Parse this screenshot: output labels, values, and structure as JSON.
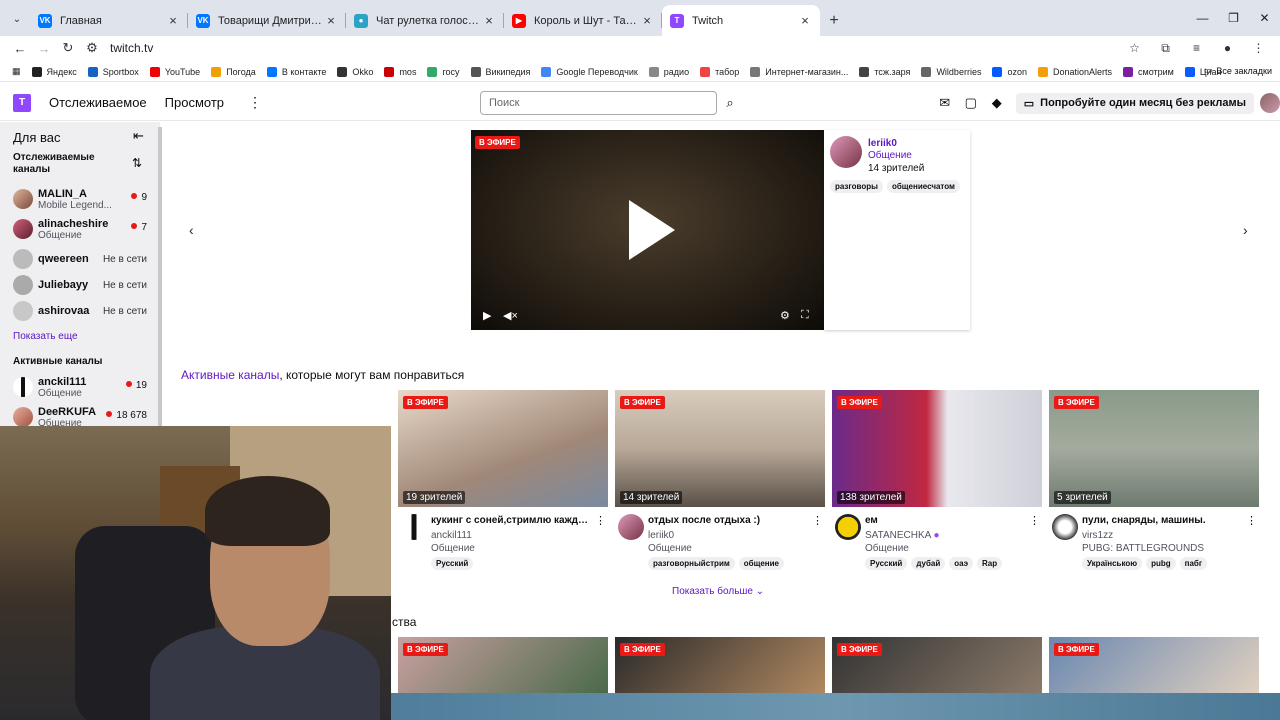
{
  "browser": {
    "tabs": [
      {
        "title": "Главная",
        "icon_color": "#0077ff"
      },
      {
        "title": "Товарищи Дмитрия Зорина –",
        "icon_color": "#0077ff"
      },
      {
        "title": "Чат рулетка голосовая — Ne",
        "icon_color": "#2aa3c7"
      },
      {
        "title": "Король и Шут - Танец злобн",
        "icon_color": "#ff0000"
      },
      {
        "title": "Twitch",
        "icon_color": "#9147ff"
      }
    ],
    "url": "twitch.tv",
    "bookmarks": [
      "Яндекс",
      "Sportbox",
      "YouTube",
      "Погода",
      "В контакте",
      "Okko",
      "mos",
      "госу",
      "Википедия",
      "Google Переводчик",
      "радио",
      "табор",
      "Интернет-магазин...",
      "тсж.заря",
      "Wildberries",
      "ozon",
      "DonationAlerts",
      "смотрим",
      "Циан"
    ],
    "all_bookmarks": "Все закладки"
  },
  "nav": {
    "following": "Отслеживаемое",
    "browse": "Просмотр",
    "search_placeholder": "Поиск",
    "promo": "Попробуйте один месяц без рекламы"
  },
  "sidebar": {
    "title": "Для вас",
    "followed_title": "Отслеживаемые каналы",
    "followed": [
      {
        "name": "MALIN_A",
        "category": "Mobile Legend...",
        "viewers": "9",
        "online": true
      },
      {
        "name": "alinacheshire",
        "category": "Общение",
        "viewers": "7",
        "online": true
      },
      {
        "name": "qweereen",
        "status": "Не в сети",
        "online": false
      },
      {
        "name": "Juliebayy",
        "status": "Не в сети",
        "online": false
      },
      {
        "name": "ashirovaa",
        "status": "Не в сети",
        "online": false
      }
    ],
    "show_more": "Показать еще",
    "active_title": "Активные каналы",
    "active": [
      {
        "name": "anckil111",
        "category": "Общение",
        "viewers": "19"
      },
      {
        "name": "DeeRKUFA",
        "category": "Общение",
        "viewers": "18 678"
      }
    ]
  },
  "featured": {
    "live": "В ЭФИРЕ",
    "name": "leriik0",
    "category": "Общение",
    "viewers": "14 зрителей",
    "tags": [
      "разговоры",
      "общениесчатом"
    ]
  },
  "section": {
    "title_accent": "Активные каналы",
    "title_rest": ", которые могут вам понравиться",
    "cards": [
      {
        "live": "В ЭФИРЕ",
        "views": "19 зрителей",
        "title": "кукинг с соней,стримлю каждый...",
        "user": "anckil111",
        "category": "Общение",
        "tags": [
          "Русский"
        ]
      },
      {
        "live": "В ЭФИРЕ",
        "views": "14 зрителей",
        "title": "отдых после отдыха :)",
        "user": "leriik0",
        "category": "Общение",
        "tags": [
          "разговорныйстрим",
          "общение"
        ]
      },
      {
        "live": "В ЭФИРЕ",
        "views": "138 зрителей",
        "title": "ем",
        "user": "SATANECHKA",
        "category": "Общение",
        "tags": [
          "Русский",
          "дубай",
          "оаэ",
          "Rap"
        ]
      },
      {
        "live": "В ЭФИРЕ",
        "views": "5 зрителей",
        "title": "пули, снаряды, машины.",
        "user": "virs1zz",
        "category": "PUBG: BATTLEGROUNDS",
        "tags": [
          "Українською",
          "pubg",
          "пабг"
        ]
      }
    ],
    "show_more": "Показать больше"
  },
  "section2": {
    "title": "ства",
    "live": "В ЭФИРЕ"
  }
}
